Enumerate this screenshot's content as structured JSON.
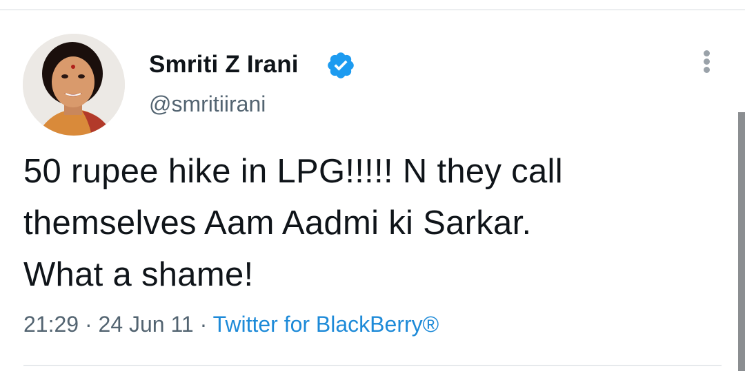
{
  "author": {
    "display_name": "Smriti Z Irani",
    "handle": "@smritiirani",
    "verified_icon": "verified-badge-icon"
  },
  "tweet": {
    "lines": [
      "50 rupee hike in LPG!!!!! N they call",
      "themselves Aam Aadmi ki Sarkar.",
      "What a shame!"
    ]
  },
  "meta": {
    "time": "21:29",
    "date": "24 Jun 11",
    "separator": "·",
    "source": "Twitter for BlackBerry®"
  },
  "icons": {
    "more": "more-vertical-icon"
  },
  "colors": {
    "text": "#0f1419",
    "secondary": "#536471",
    "link": "#1d8ad8",
    "verified": "#1d9bf0"
  }
}
